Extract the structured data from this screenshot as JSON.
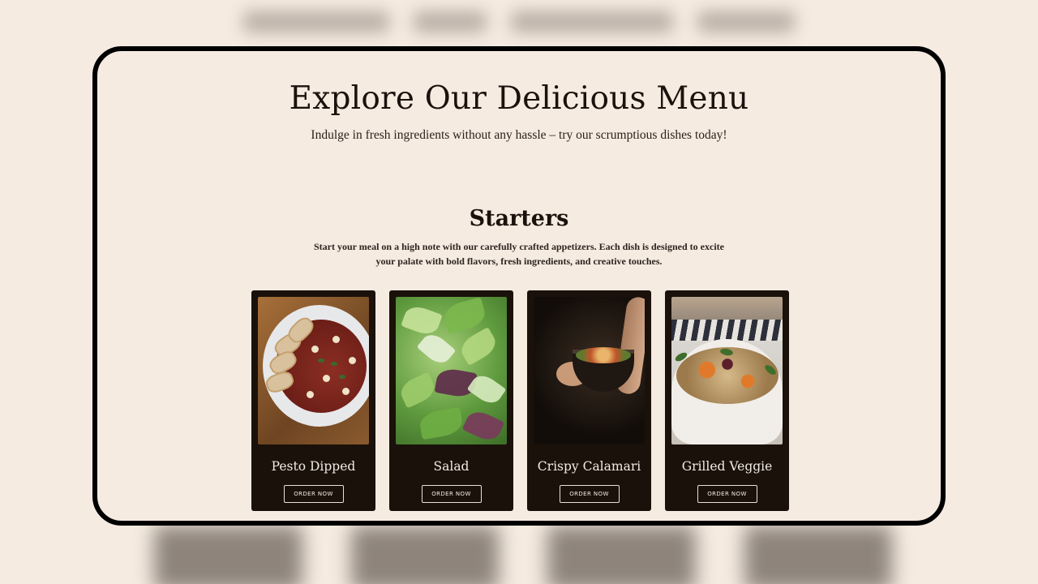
{
  "hero": {
    "title": "Explore Our Delicious Menu",
    "subtitle": "Indulge in fresh ingredients without any hassle – try our scrumptious dishes today!"
  },
  "section": {
    "title": "Starters",
    "description": "Start your meal on a high note with our carefully crafted appetizers. Each dish is designed to excite your palate with bold flavors, fresh ingredients, and creative touches."
  },
  "cards": [
    {
      "name": "Pesto Dipped",
      "button": "ORDER NOW"
    },
    {
      "name": "Salad",
      "button": "ORDER NOW"
    },
    {
      "name": "Crispy Calamari",
      "button": "ORDER NOW"
    },
    {
      "name": "Grilled Veggie",
      "button": "ORDER NOW"
    }
  ]
}
